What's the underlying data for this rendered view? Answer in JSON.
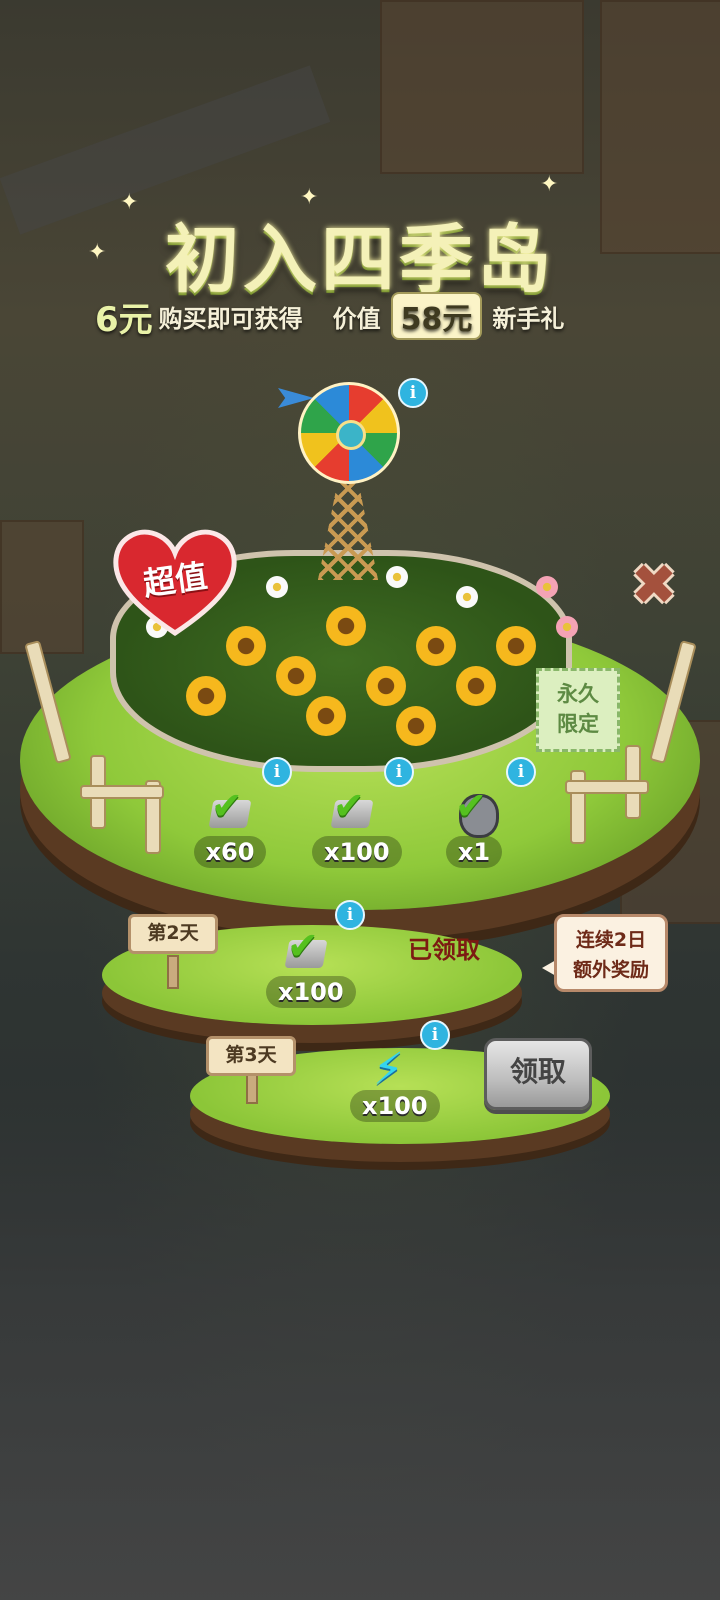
{
  "title": "初入四季岛",
  "subtitle": {
    "price": "6元",
    "price_text": "购买即可获得",
    "value_prefix": "价值",
    "value_amount": "58元",
    "value_suffix": "新手礼"
  },
  "badge": {
    "label": "超值"
  },
  "stamp": {
    "line1": "永久",
    "line2": "限定"
  },
  "rewards_day1": [
    {
      "icon": "check-box-icon",
      "count": "x60"
    },
    {
      "icon": "check-box-icon",
      "count": "x100"
    },
    {
      "icon": "raccoon-icon",
      "count": "x1"
    }
  ],
  "day2": {
    "label": "第2天",
    "reward_count": "x100",
    "status": "已领取"
  },
  "day3": {
    "label": "第3天",
    "reward_count": "x100",
    "button": "领取"
  },
  "bubble": {
    "line1": "连续2日",
    "line2": "额外奖励"
  },
  "info_glyph": "i",
  "close_glyph": "✖",
  "colors": {
    "accent_red": "#d9282f",
    "grass": "#8fc93a",
    "info_blue": "#2fb4e0"
  }
}
